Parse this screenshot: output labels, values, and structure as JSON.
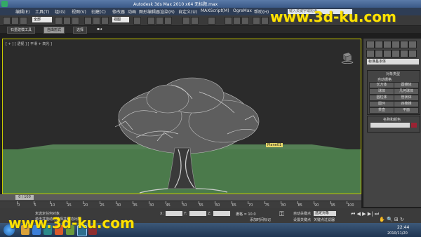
{
  "window": {
    "title": "Autodesk 3ds Max 2010 x64  无标题.max"
  },
  "menu": {
    "items": [
      "编辑(E)",
      "工具(T)",
      "组(G)",
      "视图(V)",
      "创建(C)",
      "修改器",
      "动画",
      "图形编辑器",
      "渲染(R)",
      "自定义(U)",
      "MAXScript(M)",
      "OgreMax",
      "帮助(H)"
    ],
    "search_placeholder": "键入关键字或短语"
  },
  "toolbar": {
    "selection_filter": "全部",
    "view_dropdown": "视图"
  },
  "ribbon": {
    "tabs": [
      "石墨建模工具",
      "自由形式",
      "选择"
    ]
  },
  "viewport": {
    "label": "[ + ] [ 透视 ] [ 平滑 + 高光 ]",
    "object_label": "Plane01"
  },
  "command_panel": {
    "dropdown": "标准基本体",
    "section1_title": "对象类型",
    "autogrid": "自动栅格",
    "buttons": [
      "长方体",
      "圆锥体",
      "球体",
      "几何球体",
      "圆柱体",
      "管状体",
      "圆环",
      "四棱锥",
      "茶壶",
      "平面"
    ],
    "section2_title": "名称和颜色"
  },
  "timeline": {
    "frame": "0 / 100",
    "ticks": [
      "0",
      "5",
      "10",
      "15",
      "20",
      "25",
      "30",
      "35",
      "40",
      "45",
      "50",
      "55",
      "60",
      "65",
      "70",
      "75",
      "80",
      "85",
      "90",
      "95",
      "100"
    ]
  },
  "status": {
    "selection": "未选定任何对象",
    "prompt": "单击并拖动以选择并移动对象",
    "x_label": "X:",
    "y_label": "Y:",
    "z_label": "Z:",
    "grid": "栅格 = 10.0",
    "add_time_tag": "添加时间标记",
    "auto_key": "自动关键点",
    "set_key": "设置关键点",
    "key_filter": "选定对象",
    "key_filters_btn": "关键点过滤器"
  },
  "taskbar": {
    "time": "22:44",
    "date": "2010/11/20"
  },
  "watermark": {
    "text": "www.3d-ku.com"
  },
  "colors": {
    "viewport_border": "#c8c800",
    "ground": "#4b7a4b",
    "watermark": "#ffe200"
  }
}
